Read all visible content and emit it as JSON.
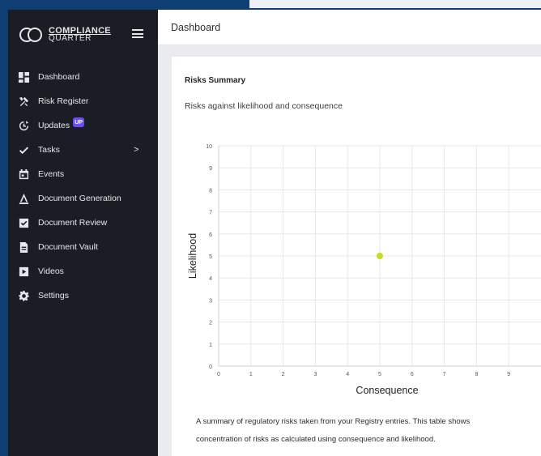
{
  "app": {
    "logo_line1": "COMPLIANCE",
    "logo_line2": "QUARTER"
  },
  "sidebar": {
    "items": [
      {
        "label": "Dashboard",
        "icon": "dashboard-icon"
      },
      {
        "label": "Risk Register",
        "icon": "tools-icon"
      },
      {
        "label": "Updates",
        "icon": "updates-icon",
        "badge": "UP"
      },
      {
        "label": "Tasks",
        "icon": "check-icon",
        "chevron": ">"
      },
      {
        "label": "Events",
        "icon": "calendar-icon"
      },
      {
        "label": "Document Generation",
        "icon": "document-generation-icon"
      },
      {
        "label": "Document Review",
        "icon": "document-review-icon"
      },
      {
        "label": "Document Vault",
        "icon": "document-vault-icon"
      },
      {
        "label": "Videos",
        "icon": "video-icon"
      },
      {
        "label": "Settings",
        "icon": "gear-icon"
      }
    ]
  },
  "header": {
    "title": "Dashboard"
  },
  "card": {
    "title": "Risks Summary",
    "subtitle": "Risks against likelihood and consequence",
    "description_line1": "A summary of regulatory risks taken from your Registry entries. This table shows",
    "description_line2": "concentration of risks as calculated using consequence and likelihood."
  },
  "chart_data": {
    "type": "scatter",
    "xlabel": "Consequence",
    "ylabel": "Likelihood",
    "xlim": [
      0,
      10
    ],
    "ylim": [
      0,
      10
    ],
    "x_ticks": [
      "0",
      "1",
      "2",
      "3",
      "4",
      "5",
      "6",
      "7",
      "8",
      "9"
    ],
    "y_ticks": [
      "0",
      "1",
      "2",
      "3",
      "4",
      "5",
      "6",
      "7",
      "8",
      "9",
      "10"
    ],
    "grid": true,
    "point_color": "#c8dc1e",
    "points": [
      {
        "x": 5,
        "y": 5
      }
    ]
  },
  "colors": {
    "sidebar_bg": "#1a1e24",
    "page_frame": "#0f3e72",
    "badge": "#6b4cff"
  }
}
